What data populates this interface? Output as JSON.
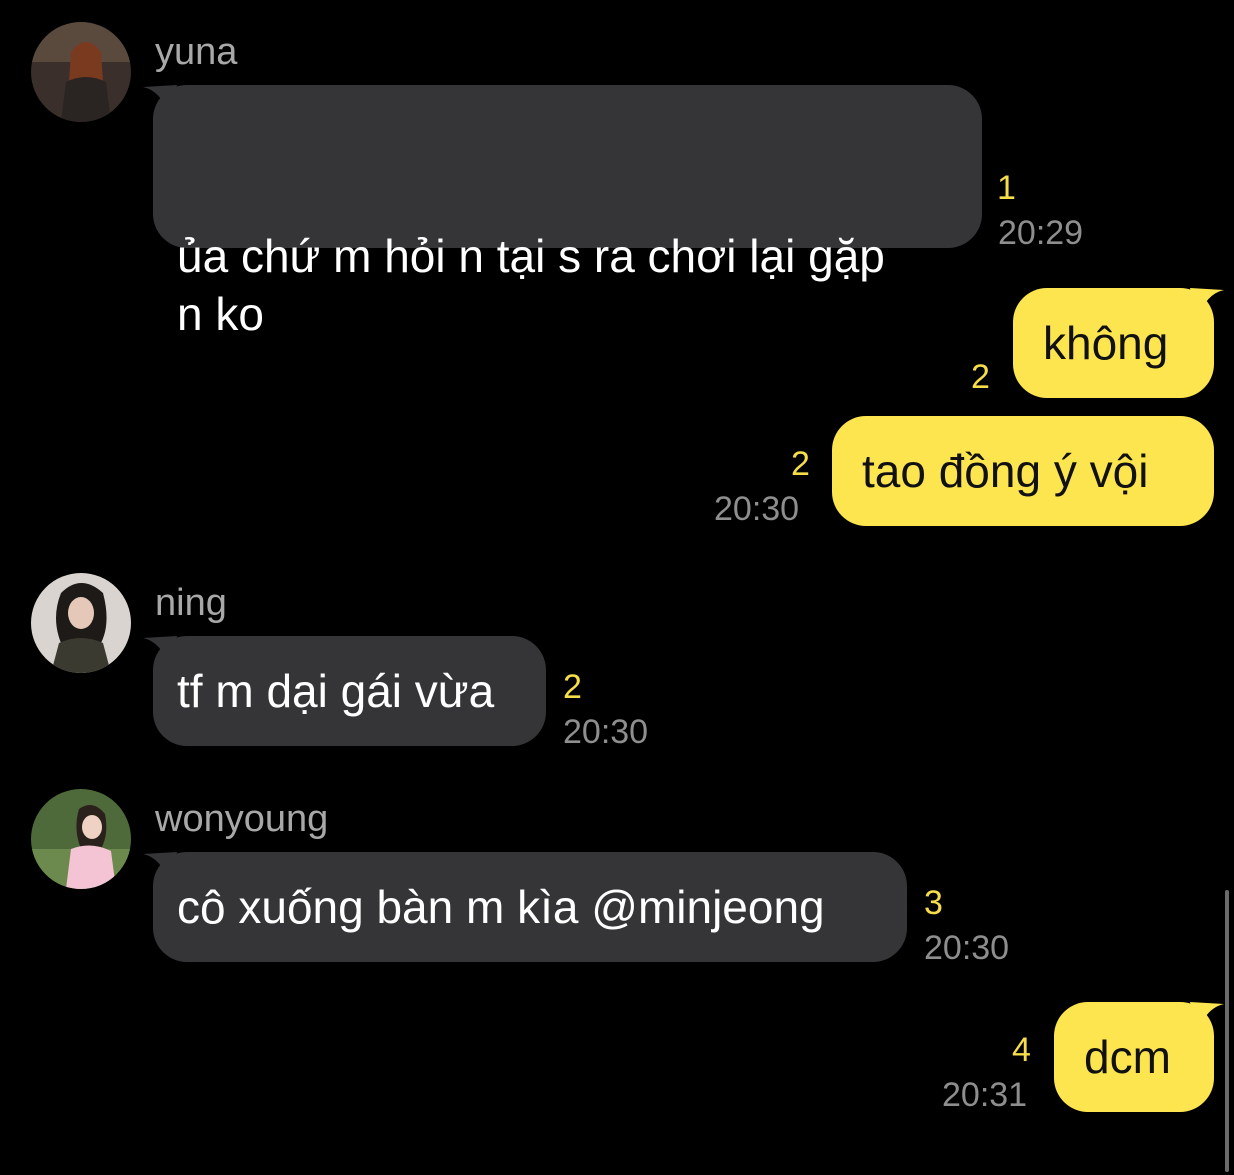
{
  "messages": [
    {
      "sender": "yuna",
      "direction": "incoming",
      "text": "ủa chứ m hỏi n tại s ra chơi lại gặp\nn ko",
      "unread": "1",
      "time": "20:29"
    },
    {
      "direction": "outgoing",
      "text": "không",
      "unread": "2",
      "time": ""
    },
    {
      "direction": "outgoing",
      "text": "tao đồng ý vội",
      "unread": "2",
      "time": "20:30"
    },
    {
      "sender": "ning",
      "direction": "incoming",
      "text": "tf m dại gái vừa",
      "unread": "2",
      "time": "20:30"
    },
    {
      "sender": "wonyoung",
      "direction": "incoming",
      "text": "cô xuống bàn m kìa @minjeong",
      "unread": "3",
      "time": "20:30"
    },
    {
      "direction": "outgoing",
      "text": "dcm",
      "unread": "4",
      "time": "20:31"
    }
  ],
  "colors": {
    "background": "#000000",
    "incoming_bubble": "#353538",
    "outgoing_bubble": "#fce54f",
    "unread_count": "#f5dd4b",
    "timestamp": "#8e8e8e",
    "sender_name": "#a8a8a8"
  }
}
